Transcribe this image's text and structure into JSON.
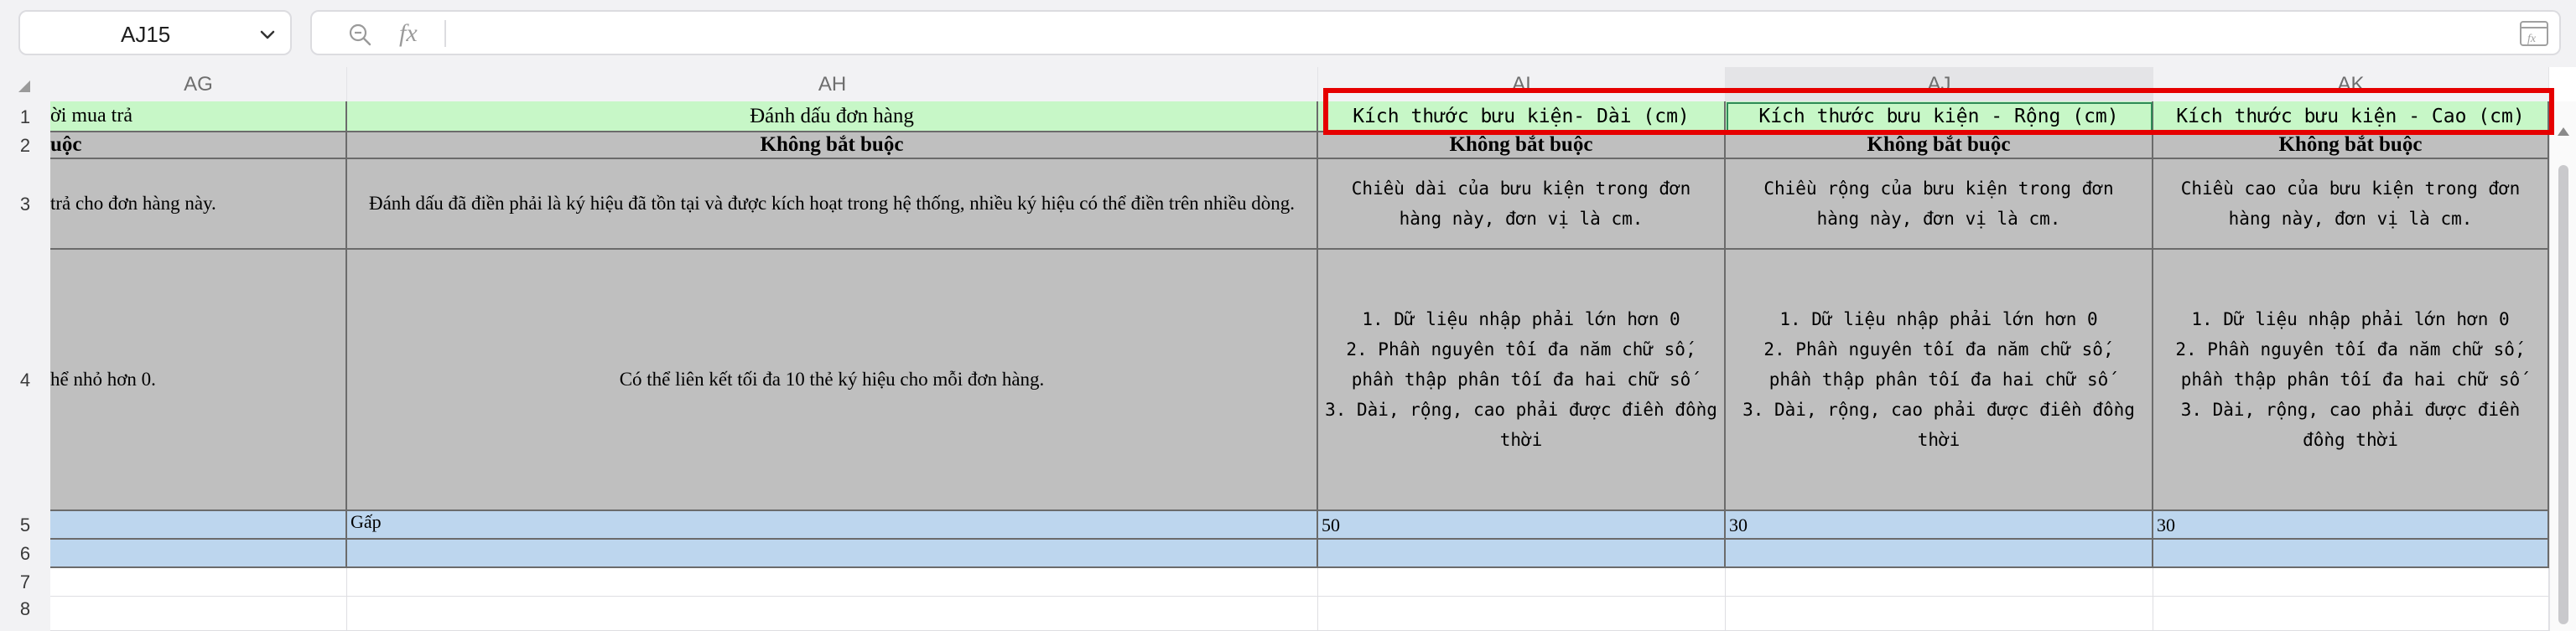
{
  "formula_bar": {
    "name_box": "AJ15",
    "fx_label": "fx",
    "formula_value": ""
  },
  "columns": [
    {
      "id": "AG",
      "label": "AG"
    },
    {
      "id": "AH",
      "label": "AH"
    },
    {
      "id": "AI",
      "label": "AI"
    },
    {
      "id": "AJ",
      "label": "AJ"
    },
    {
      "id": "AK",
      "label": "AK"
    }
  ],
  "rows": [
    "1",
    "2",
    "3",
    "4",
    "5",
    "6",
    "7",
    "8"
  ],
  "cells": {
    "AG1": "ời mua trả",
    "AH1": "Đánh dấu đơn hàng",
    "AI1": "Kích thước bưu kiện- Dài (cm)",
    "AJ1": "Kích thước bưu kiện - Rộng (cm)",
    "AK1": "Kích thước bưu kiện - Cao (cm)",
    "AG2": "uộc",
    "AH2": "Không bắt buộc",
    "AI2": "Không bắt buộc",
    "AJ2": "Không bắt buộc",
    "AK2": "Không bắt buộc",
    "AG3": "trả cho đơn hàng này.",
    "AH3": "Đánh dấu đã điền phải là ký hiệu đã tồn tại và được kích hoạt trong hệ thống, nhiều ký hiệu có thể điền trên nhiều dòng.",
    "AI3": "Chiều dài của bưu kiện trong đơn hàng này, đơn vị là cm.",
    "AJ3": "Chiều rộng của bưu kiện trong đơn hàng này, đơn vị là cm.",
    "AK3": "Chiều cao của bưu kiện trong đơn hàng này, đơn vị là cm.",
    "AG4": "hể nhỏ hơn 0.",
    "AH4": "Có thể liên kết tối đa 10 thẻ ký hiệu cho mỗi đơn hàng.",
    "AI4": "1. Dữ liệu nhập phải lớn hơn 0\n2. Phần nguyên tối đa năm chữ số, phần thập phân tối đa hai chữ số\n3. Dài, rộng, cao phải được điền đồng thời",
    "AJ4": "1. Dữ liệu nhập phải lớn hơn 0\n2. Phần nguyên tối đa năm chữ số, phần thập phân tối đa hai chữ số\n3. Dài, rộng, cao phải được điền đồng thời",
    "AK4": "1. Dữ liệu nhập phải lớn hơn 0\n2. Phần nguyên tối đa năm chữ số, phần thập phân tối đa hai chữ số\n3. Dài, rộng, cao phải được điền đồng thời",
    "AG5": "",
    "AH5": "Gấp",
    "AI5": "50",
    "AJ5": "30",
    "AK5": "30"
  },
  "colors": {
    "header_row_fill": "#c7f7c7",
    "description_fill": "#bfbfbf",
    "data_row_fill": "#bdd6ee",
    "highlight_box": "#e60000"
  },
  "icons": {
    "name_box_dropdown": "chevron-down-icon",
    "zoom": "zoom-icon",
    "insert_function": "function-icon",
    "select_all": "select-all-triangle-icon",
    "scroll_up": "scroll-up-icon"
  }
}
